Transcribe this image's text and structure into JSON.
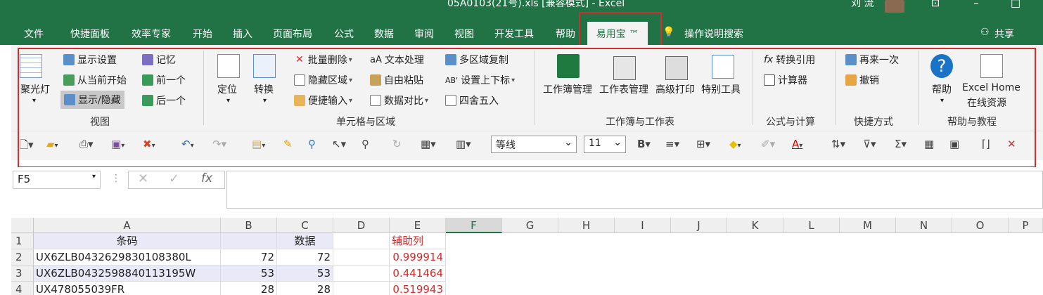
{
  "window": {
    "title": "05A0103(21号).xls  [兼容模式]  -  Excel",
    "user": "刘 流"
  },
  "tabs": [
    "文件",
    "快捷面板",
    "效率专家",
    "开始",
    "插入",
    "页面布局",
    "公式",
    "数据",
    "审阅",
    "视图",
    "开发工具",
    "帮助",
    "易用宝 ™"
  ],
  "tab_search": "操作说明搜索",
  "share": "共享",
  "ribbon": {
    "view": {
      "spotlight": "聚光灯",
      "display_settings": "显示设置",
      "from_current": "从当前开始",
      "show_hide": "显示/隐藏",
      "memory": "记忆",
      "prev": "前一个",
      "next": "后一个",
      "group": "视图"
    },
    "cells": {
      "locate": "定位",
      "convert": "转换",
      "batch_delete": "批量删除",
      "hide_area": "隐藏区域",
      "quick_input": "便捷输入",
      "text_process": "文本处理",
      "free_paste": "自由粘贴",
      "data_compare": "数据对比",
      "multi_copy": "多区域复制",
      "sup_sub": "设置上下标",
      "round": "四舍五入",
      "group": "单元格与区域"
    },
    "workbook": {
      "wb_manage": "工作簿管理",
      "ws_manage": "工作表管理",
      "adv_print": "高级打印",
      "special_tools": "特别工具",
      "group": "工作簿与工作表"
    },
    "formula": {
      "convert_ref": "转换引用",
      "calculator": "计算器",
      "group": "公式与计算"
    },
    "shortcut": {
      "redo": "再来一次",
      "undo": "撤销",
      "group": "快捷方式"
    },
    "help": {
      "help": "帮助",
      "excel_home": "Excel Home",
      "online": "在线资源",
      "group": "帮助与教程"
    }
  },
  "toolbar": {
    "font": "等线",
    "size": "11"
  },
  "namebox": "F5",
  "columns": [
    "A",
    "B",
    "C",
    "D",
    "E",
    "F",
    "G",
    "H",
    "I",
    "J",
    "K",
    "L",
    "M",
    "N",
    "O",
    "P"
  ],
  "rows": [
    {
      "n": "1",
      "a": "条码",
      "b": "",
      "c": "数据",
      "e": "辅助列"
    },
    {
      "n": "2",
      "a": "UX6ZLB0432629830108380L",
      "b": "72",
      "c": "72",
      "e": "0.999914"
    },
    {
      "n": "3",
      "a": "UX6ZLB0432598840113195W",
      "b": "53",
      "c": "53",
      "e": "0.441464"
    },
    {
      "n": "4",
      "a": "UX478055039FR",
      "b": "28",
      "c": "28",
      "e": "0.519943"
    }
  ]
}
